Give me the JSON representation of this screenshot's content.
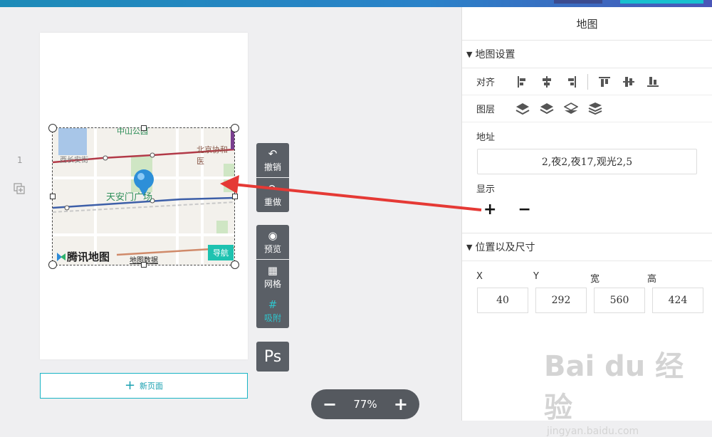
{
  "page_list": {
    "page_number": "1",
    "new_page_label": "新页面"
  },
  "map": {
    "logo_text": "腾讯地图",
    "data_text": "地图数据",
    "nav_label": "导航",
    "labels": [
      "中山公园",
      "北京协和医",
      "西长安街",
      "天安门广场"
    ]
  },
  "tools": {
    "undo": "撤销",
    "redo": "重做",
    "preview": "预览",
    "grid": "网格",
    "snap": "吸附",
    "ps": "Ps"
  },
  "zoom": {
    "minus": "−",
    "value": "77%",
    "plus": "+"
  },
  "panel": {
    "title": "地图",
    "map_settings": "地图设置",
    "align_label": "对齐",
    "layer_label": "图层",
    "address_label": "地址",
    "address_value": "2,夜2,夜17,观光2,5",
    "display_label": "显示",
    "display_plus": "+",
    "display_minus": "−",
    "position_section": "位置以及尺寸",
    "fields": {
      "x_label": "X",
      "y_label": "Y",
      "w_label": "宽",
      "h_label": "高",
      "x": "40",
      "y": "292",
      "w": "560",
      "h": "424"
    }
  },
  "watermark": {
    "brand": "Bai du 经验",
    "url": "jingyan.baidu.com"
  },
  "colors": {
    "accent": "#19b4c4",
    "arrow": "#e53935",
    "tool_bg": "#5a5f66"
  }
}
